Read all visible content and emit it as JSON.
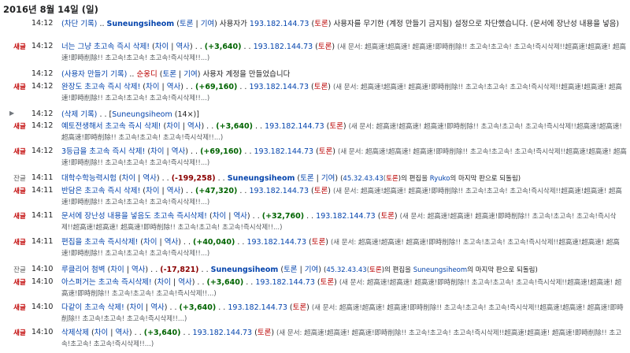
{
  "date_heading": "2016년 8월 14일 (일)",
  "common": {
    "diff": "차이",
    "history": "역사",
    "talk": "토론",
    "contrib": "기여",
    "ip": "193.182.144.73",
    "spam": "(새 문서: 超高速!超高速! 超高速!即時削除!! 초고속!초고속! 초고속!즉시삭제!!超高速!超高速! 超高速!即時削除!! 초고속!초고속! 초고속!즉시삭제!!...)"
  },
  "block_log": {
    "time": "14:12",
    "action": "(차단 기록)",
    "user": "Suneungsiheom",
    "text1": "사용자가",
    "text2": "사용자를 무기한 (계정 만들기 금지됨) 설정으로 차단했습니다. (문서에 장난성 내용을 넣음)"
  },
  "create_log": {
    "time": "14:12",
    "action": "(사용자 만들기 기록)",
    "user": "순옹디",
    "text": "사용자 계정을 만들었습니다"
  },
  "delete_group": {
    "time": "14:12",
    "action": "(삭제 기록)",
    "user": "Suneungsiheom",
    "count": "(14×)"
  },
  "rows": [
    {
      "flag": "새글",
      "time": "14:12",
      "title": "너는 그냥 초고속 즉시 삭제!",
      "delta": "(+3,640)"
    },
    {
      "flag": "새글",
      "time": "14:12",
      "title": "완장도 초고속 즉시 삭제!",
      "delta": "(+69,160)"
    },
    {
      "flag": "새글",
      "time": "14:12",
      "title": "예토전생해서 초고속 즉시 삭제!",
      "delta": "(+3,640)"
    },
    {
      "flag": "새글",
      "time": "14:12",
      "title": "3등급을 초고속 즉시 삭제!",
      "delta": "(+69,160)"
    },
    {
      "flag": "새글",
      "time": "14:11",
      "title": "반담은 초고속 즉시 삭제!",
      "delta": "(+47,320)"
    },
    {
      "flag": "새글",
      "time": "14:11",
      "title": "문서에 장난성 내용을 넣음도 초고속 즉시삭제!",
      "delta": "(+32,760)"
    },
    {
      "flag": "새글",
      "time": "14:11",
      "title": "편집을 초고속 즉시삭제!",
      "delta": "(+40,040)"
    },
    {
      "flag": "새글",
      "time": "14:10",
      "title": "아스퍼거는 초고속 즉시삭제!",
      "delta": "(+3,640)"
    },
    {
      "flag": "새글",
      "time": "14:10",
      "title": "다같이 초고속 삭제!",
      "delta": "(+3,640)"
    },
    {
      "flag": "새글",
      "time": "14:10",
      "title": "삭제삭제",
      "delta": "(+3,640)"
    }
  ],
  "reverts": [
    {
      "flag": "잔글",
      "time": "14:11",
      "title": "대학수학능력시험",
      "delta": "(-199,258)",
      "user": "Suneungsiheom",
      "ip": "45.32.43.43",
      "summary_pre": "(",
      "summary_post": ")의 편집을 ",
      "reverted_to": "Ryuko",
      "summary_end": "의 마지막 판으로 되돌림)"
    },
    {
      "flag": "잔글",
      "time": "14:10",
      "title": "루클리어 첨벽",
      "delta": "(-17,821)",
      "user": "Suneungsiheom",
      "ip": "45.32.43.43",
      "summary_pre": "(",
      "summary_post": ")의 편집을 ",
      "reverted_to": "Suneungsiheom",
      "summary_end": "의 마지막 판으로 되돌림)"
    }
  ]
}
